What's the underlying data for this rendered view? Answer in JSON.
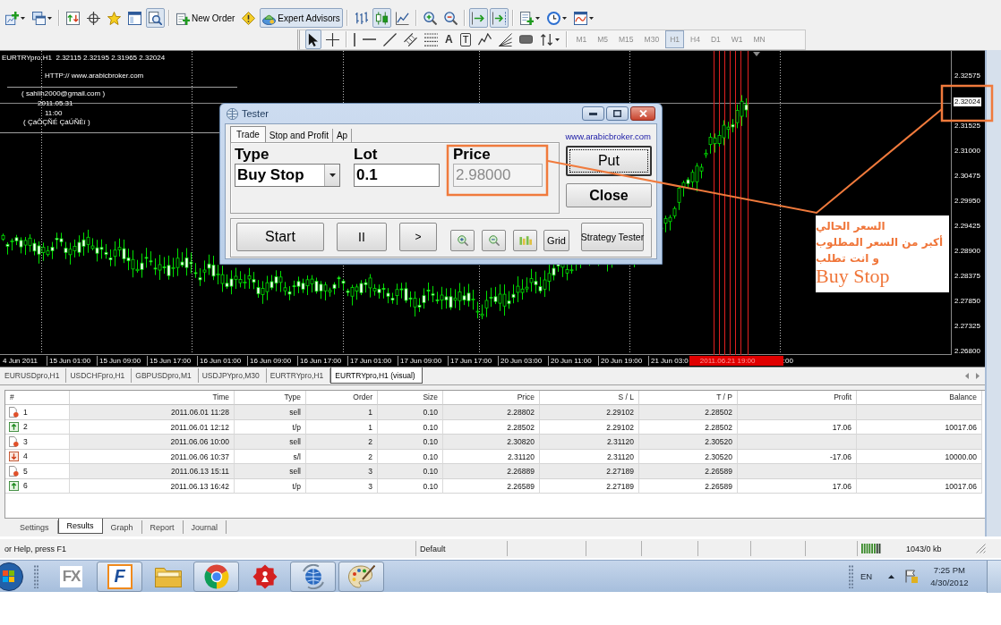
{
  "toolbar": {
    "groups": [
      [
        {
          "kind": "new-chart",
          "dropdown": true,
          "on": false
        },
        {
          "kind": "profiles",
          "dropdown": true,
          "on": false
        }
      ],
      [
        {
          "kind": "market-watch",
          "on": false
        },
        {
          "kind": "data-window",
          "on": false
        },
        {
          "kind": "navigator",
          "on": false
        },
        {
          "kind": "terminal",
          "on": false
        },
        {
          "kind": "tester",
          "on": true
        }
      ],
      [
        {
          "kind": "new-order",
          "label": "New Order",
          "on": false
        },
        {
          "kind": "editor",
          "on": false
        },
        {
          "kind": "expert-advisors",
          "label": "Expert Advisors",
          "on": true
        }
      ],
      [
        {
          "kind": "bar-chart",
          "on": false
        },
        {
          "kind": "candlesticks",
          "on": true
        },
        {
          "kind": "line-chart",
          "on": false
        }
      ],
      [
        {
          "kind": "zoom-in",
          "on": false
        },
        {
          "kind": "zoom-out",
          "on": false
        }
      ],
      [
        {
          "kind": "auto-scroll",
          "on": true
        },
        {
          "kind": "chart-shift",
          "on": true
        }
      ],
      [
        {
          "kind": "templates",
          "dropdown": true,
          "on": false
        },
        {
          "kind": "periods",
          "dropdown": true,
          "on": false
        },
        {
          "kind": "indicators",
          "dropdown": true,
          "on": false
        }
      ]
    ]
  },
  "drawing_toolbar": {
    "groups": [
      [
        {
          "kind": "cursor",
          "on": true
        },
        {
          "kind": "crosshair",
          "on": false
        }
      ],
      [
        {
          "kind": "vertical-line",
          "on": false
        },
        {
          "kind": "horizontal-line",
          "on": false
        },
        {
          "kind": "trend-line",
          "on": false
        },
        {
          "kind": "channel",
          "on": false
        },
        {
          "kind": "fibonacci",
          "on": false
        },
        {
          "kind": "text",
          "glyph": "A",
          "on": false
        },
        {
          "kind": "text-label",
          "glyph": "T",
          "on": false
        },
        {
          "kind": "zigzag",
          "on": false
        },
        {
          "kind": "fan",
          "on": false
        },
        {
          "kind": "rectangle",
          "on": false
        },
        {
          "kind": "arrows",
          "dropdown": true,
          "on": false
        }
      ]
    ],
    "timeframes": [
      {
        "label": "M1",
        "selected": false
      },
      {
        "label": "M5",
        "selected": false
      },
      {
        "label": "M15",
        "selected": false
      },
      {
        "label": "M30",
        "selected": false
      },
      {
        "label": "H1",
        "selected": true
      },
      {
        "label": "H4",
        "selected": false
      },
      {
        "label": "D1",
        "selected": false
      },
      {
        "label": "W1",
        "selected": false
      },
      {
        "label": "MN",
        "selected": false
      }
    ]
  },
  "chart": {
    "info": "EURTRYpro,H1  2.32115 2.32195 2.31965 2.32024",
    "notes": [
      "HTTP:// www.arabicbroker.com",
      "( sahlih2000@gmail.com )",
      "2011.05.31",
      "11:00",
      "( ÇáÔÇÑÉ ÇáÚÑÈí )"
    ],
    "price_axis": [
      {
        "label": "2.32575",
        "kind": "tick"
      },
      {
        "label": "2.32024",
        "kind": "current"
      },
      {
        "label": "2.31525",
        "kind": "tick"
      },
      {
        "label": "2.31000",
        "kind": "tick"
      },
      {
        "label": "2.30475",
        "kind": "tick"
      },
      {
        "label": "2.29950",
        "kind": "tick"
      },
      {
        "label": "2.29425",
        "kind": "tick"
      },
      {
        "label": "2.28900",
        "kind": "tick"
      },
      {
        "label": "2.28375",
        "kind": "tick"
      },
      {
        "label": "2.27850",
        "kind": "tick"
      },
      {
        "label": "2.27325",
        "kind": "tick"
      },
      {
        "label": "2.26800",
        "kind": "tick"
      }
    ],
    "time_axis": [
      "4 Jun 2011",
      "15 Jun 01:00",
      "15 Jun 09:00",
      "15 Jun 17:00",
      "16 Jun 01:00",
      "16 Jun 09:00",
      "16 Jun 17:00",
      "17 Jun 01:00",
      "17 Jun 09:00",
      "17 Jun 17:00",
      "20 Jun 03:00",
      "20 Jun 11:00",
      "20 Jun 19:00",
      "21 Jun 03:0"
    ],
    "time_marker": "2011.06.21 19:00",
    "time_axis_end": ":00",
    "annotation": {
      "lines": [
        "السعر الحالي",
        "أكبر من السعر المطلوب",
        "و انت تطلب"
      ],
      "emphasis": "Buy Stop"
    }
  },
  "tester_dialog": {
    "title": "Tester",
    "tabs": [
      {
        "label": "Trade",
        "selected": true
      },
      {
        "label": "Stop and Profit",
        "selected": false
      },
      {
        "label": "Ap",
        "selected": false
      }
    ],
    "link": "www.arabicbroker.com",
    "type": {
      "label": "Type",
      "value": "Buy Stop"
    },
    "lot": {
      "label": "Lot",
      "value": "0.1"
    },
    "price": {
      "label": "Price",
      "value": "2.98000",
      "disabled": true
    },
    "buttons": [
      {
        "kind": "put",
        "label": "Put",
        "focused": true
      },
      {
        "kind": "close",
        "label": "Close",
        "focused": false
      }
    ],
    "controls": [
      {
        "kind": "start",
        "label": "Start"
      },
      {
        "kind": "pause",
        "label": "II"
      },
      {
        "kind": "step",
        "label": ">"
      },
      {
        "kind": "zoom-in"
      },
      {
        "kind": "zoom-out"
      },
      {
        "kind": "bars"
      },
      {
        "kind": "grid",
        "label": "Grid"
      },
      {
        "kind": "strategy-tester",
        "label": "Strategy Tester"
      }
    ]
  },
  "chart_tabs": [
    {
      "label": "EURUSDpro,H1",
      "selected": false
    },
    {
      "label": "USDCHFpro,H1",
      "selected": false
    },
    {
      "label": "GBPUSDpro,M1",
      "selected": false
    },
    {
      "label": "USDJPYpro,M30",
      "selected": false
    },
    {
      "label": "EURTRYpro,H1",
      "selected": false
    },
    {
      "label": "EURTRYpro,H1 (visual)",
      "selected": true
    }
  ],
  "tester": {
    "columns": [
      "#",
      "Time",
      "Type",
      "Order",
      "Size",
      "Price",
      "S / L",
      "T / P",
      "Profit",
      "Balance"
    ],
    "rows": [
      {
        "kind": "sell",
        "number": "1",
        "time": "2011.06.01 11:28",
        "type": "sell",
        "order": "1",
        "size": "0.10",
        "price": "2.28802",
        "sl": "2.29102",
        "tp": "2.28502"
      },
      {
        "kind": "take-profit",
        "number": "2",
        "time": "2011.06.01 12:12",
        "type": "t/p",
        "order": "1",
        "size": "0.10",
        "price": "2.28502",
        "sl": "2.29102",
        "tp": "2.28502",
        "profit": "17.06",
        "balance": "10017.06"
      },
      {
        "kind": "sell",
        "number": "3",
        "time": "2011.06.06 10:00",
        "type": "sell",
        "order": "2",
        "size": "0.10",
        "price": "2.30820",
        "sl": "2.31120",
        "tp": "2.30520"
      },
      {
        "kind": "stop-loss",
        "number": "4",
        "time": "2011.06.06 10:37",
        "type": "s/l",
        "order": "2",
        "size": "0.10",
        "price": "2.31120",
        "sl": "2.31120",
        "tp": "2.30520",
        "profit": "-17.06",
        "balance": "10000.00"
      },
      {
        "kind": "sell",
        "number": "5",
        "time": "2011.06.13 15:11",
        "type": "sell",
        "order": "3",
        "size": "0.10",
        "price": "2.26889",
        "sl": "2.27189",
        "tp": "2.26589"
      },
      {
        "kind": "take-profit",
        "number": "6",
        "time": "2011.06.13 16:42",
        "type": "t/p",
        "order": "3",
        "size": "0.10",
        "price": "2.26589",
        "sl": "2.27189",
        "tp": "2.26589",
        "profit": "17.06",
        "balance": "10017.06"
      }
    ],
    "tabs": [
      {
        "label": "Settings",
        "selected": false
      },
      {
        "label": "Results",
        "selected": true
      },
      {
        "label": "Graph",
        "selected": false
      },
      {
        "label": "Report",
        "selected": false
      },
      {
        "label": "Journal",
        "selected": false
      }
    ]
  },
  "status_bar": {
    "help": "or Help, press F1",
    "profile": "Default",
    "traffic": "1043/0 kb"
  },
  "taskbar": {
    "apps": [
      {
        "kind": "fx",
        "glyph": "FX",
        "running": false
      },
      {
        "kind": "f-logo",
        "glyph": "F",
        "running": true
      },
      {
        "kind": "folder",
        "running": false
      },
      {
        "kind": "browser",
        "running": true
      },
      {
        "kind": "gear",
        "running": false
      },
      {
        "kind": "globe",
        "running": true
      },
      {
        "kind": "palette",
        "running": true
      }
    ],
    "language": "EN",
    "time": "7:25 PM",
    "date": "4/30/2012"
  }
}
